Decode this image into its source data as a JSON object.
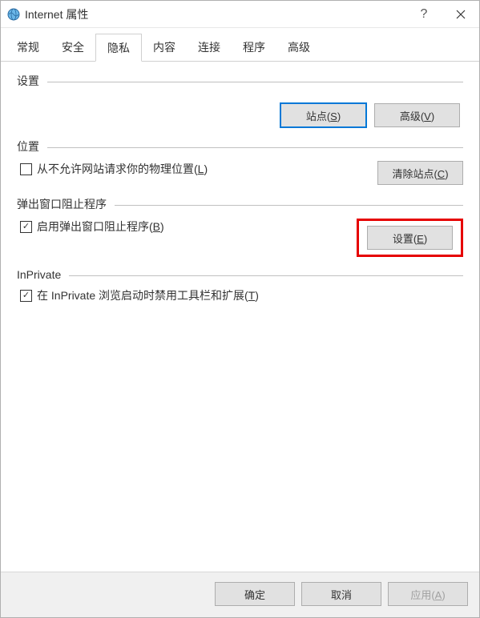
{
  "titlebar": {
    "title": "Internet 属性"
  },
  "tabs": [
    {
      "label": "常规"
    },
    {
      "label": "安全"
    },
    {
      "label": "隐私"
    },
    {
      "label": "内容"
    },
    {
      "label": "连接"
    },
    {
      "label": "程序"
    },
    {
      "label": "高级"
    }
  ],
  "activeTab": "隐私",
  "sections": {
    "settings": {
      "title": "设置",
      "site_btn": "站点(S)",
      "advanced_btn": "高级(V)"
    },
    "location": {
      "title": "位置",
      "checkbox_label_pre": "从不允许网站请求你的物理位置(",
      "checkbox_key": "L",
      "checkbox_label_post": ")",
      "checked": false,
      "clear_btn": "清除站点(C)"
    },
    "popup": {
      "title": "弹出窗口阻止程序",
      "checkbox_label_pre": "启用弹出窗口阻止程序(",
      "checkbox_key": "B",
      "checkbox_label_post": ")",
      "checked": true,
      "settings_btn": "设置(E)"
    },
    "inprivate": {
      "title": "InPrivate",
      "checkbox_label_pre": "在 InPrivate 浏览启动时禁用工具栏和扩展(",
      "checkbox_key": "T",
      "checkbox_label_post": ")",
      "checked": true
    }
  },
  "footer": {
    "ok": "确定",
    "cancel": "取消",
    "apply": "应用(A)"
  }
}
